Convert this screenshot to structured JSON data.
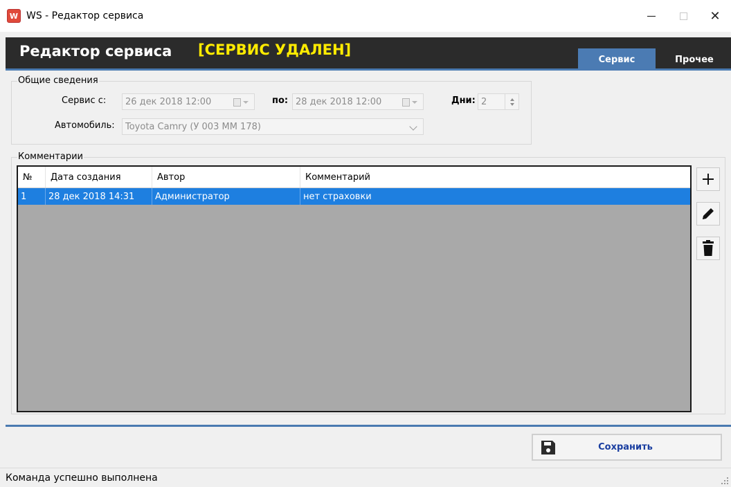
{
  "window": {
    "icon_letter": "W",
    "title": "WS - Редактор сервиса",
    "minimize": "minimize",
    "maximize": "maximize",
    "close": "✕"
  },
  "header": {
    "title": "Редактор сервиса",
    "status": "[СЕРВИС УДАЛЕН]",
    "tabs": [
      {
        "label": "Сервис",
        "active": true
      },
      {
        "label": "Прочее",
        "active": false
      }
    ],
    "accent_color": "#4b7bb3",
    "status_color": "#ffeb00"
  },
  "general": {
    "group_title": "Общие сведения",
    "service_from_label": "Сервис с:",
    "service_from_value": "26 дек 2018  12:00",
    "service_to_label": "по:",
    "service_to_value": "28 дек 2018  12:00",
    "days_label": "Дни:",
    "days_value": "2",
    "car_label": "Автомобиль:",
    "car_value": "Toyota Camry (У 003 ММ 178)"
  },
  "comments": {
    "group_title": "Комментарии",
    "columns": [
      "№",
      "Дата создания",
      "Автор",
      "Комментарий"
    ],
    "rows": [
      {
        "num": "1",
        "date": "28 дек 2018 14:31",
        "author": "Администратор",
        "comment": "нет страховки",
        "selected": true
      }
    ],
    "actions": [
      {
        "name": "plus-icon"
      },
      {
        "name": "pencil-icon"
      },
      {
        "name": "trash-icon"
      }
    ]
  },
  "footer": {
    "save_label": "Сохранить",
    "save_icon": "floppy-disk-icon"
  },
  "status_bar": {
    "text": "Команда успешно выполнена"
  }
}
